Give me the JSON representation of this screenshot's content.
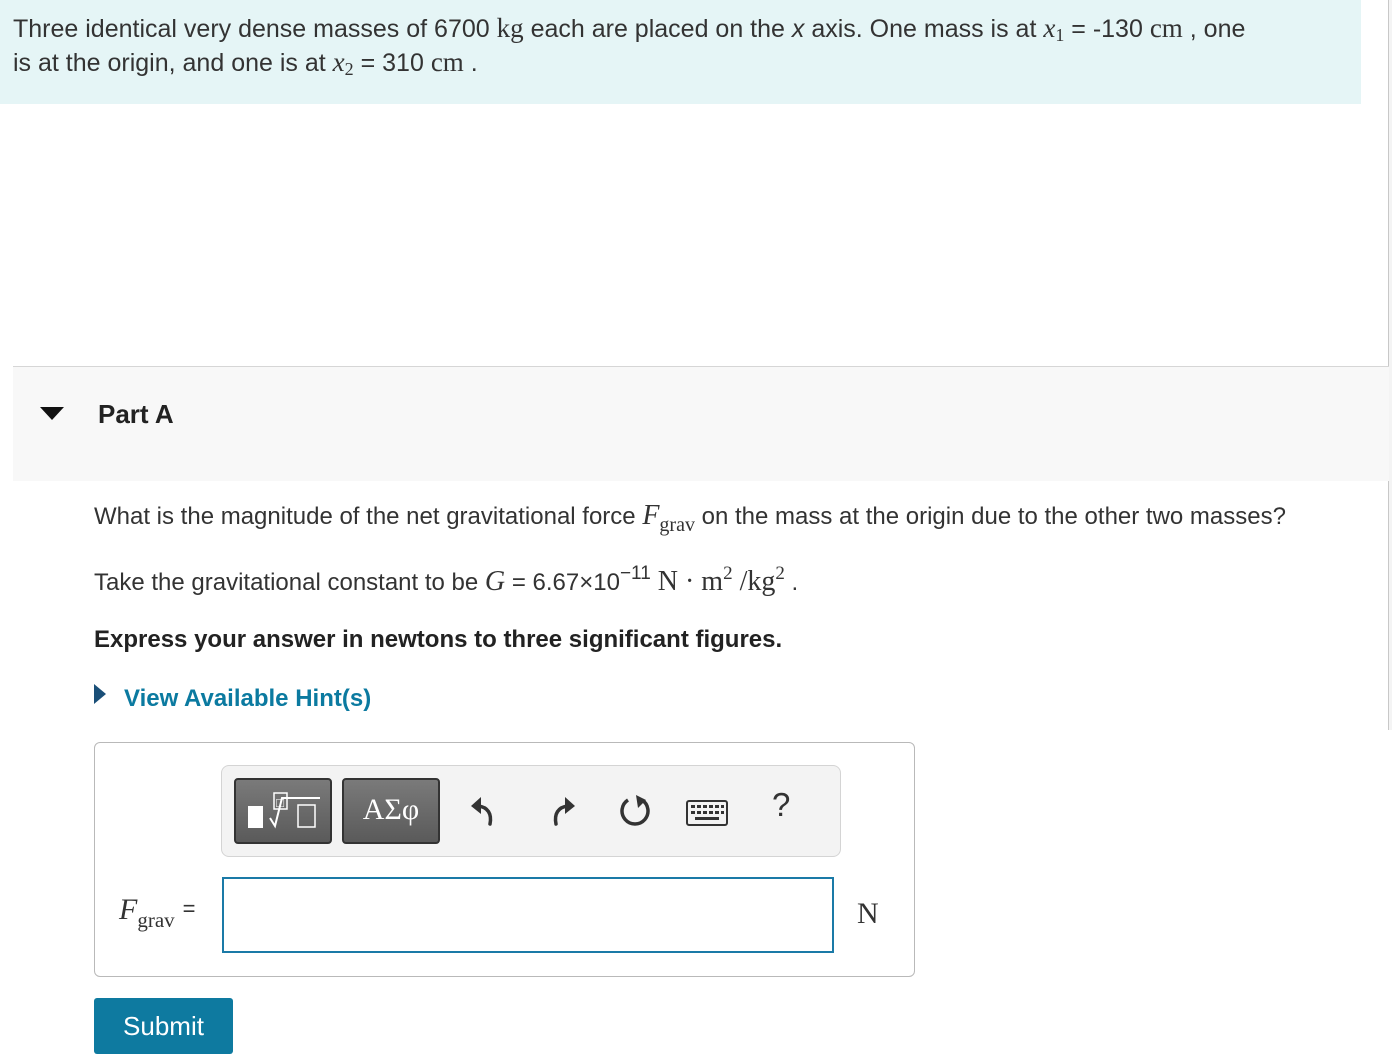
{
  "intro": {
    "t1": "Three identical very dense masses of ",
    "mass": "6700",
    "unit_kg": "kg",
    "t2": " each are placed on the ",
    "x_axis_var": "x",
    "t3": " axis. One mass is at ",
    "x1_var": "x",
    "x1_sub": "1",
    "eq1": " = ",
    "x1_val": "-130",
    "unit_cm1": "cm",
    "t4": " , one",
    "t5": "is at the origin, and one is at ",
    "x2_var": "x",
    "x2_sub": "2",
    "eq2": " = ",
    "x2_val": "310",
    "unit_cm2": "cm",
    "t6": " ."
  },
  "part": {
    "title": "Part A"
  },
  "question": {
    "q1_a": "What is the magnitude of the net gravitational force ",
    "F_var": "F",
    "F_sub": "grav",
    "q1_b": " on the mass at the origin due to the other two masses?",
    "q2_a": "Take the gravitational constant to be ",
    "G_var": "G",
    "q2_eq": " = ",
    "G_val": "6.67×10",
    "G_exp": "−11",
    "G_unit_N": " N · m",
    "G_unit_m_exp": "2",
    "G_unit_kg": " /kg",
    "G_unit_kg_exp": "2",
    "q2_end": " .",
    "instruction": "Express your answer in newtons to three significant figures."
  },
  "hint": {
    "label": "View Available Hint(s)"
  },
  "toolbar": {
    "symbols_label": "ΑΣφ",
    "help_label": "?",
    "templates_icon": "templates-icon",
    "undo_icon": "undo-icon",
    "redo_icon": "redo-icon",
    "reset_icon": "reset-icon",
    "keyboard_icon": "keyboard-icon"
  },
  "answer": {
    "label_var": "F",
    "label_sub": "grav",
    "label_eq": "=",
    "value": "",
    "unit": "N"
  },
  "submit": {
    "label": "Submit"
  },
  "colors": {
    "intro_bg": "#e5f5f6",
    "link": "#0b7aa0",
    "submit_bg": "#0e7aa0",
    "input_border": "#1a7aa7"
  }
}
